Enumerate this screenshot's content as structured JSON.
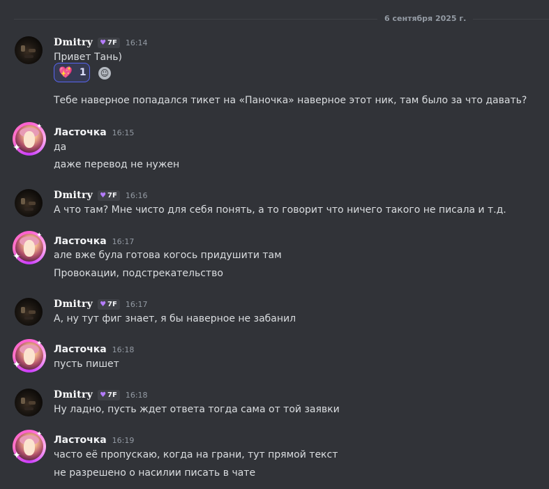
{
  "date_divider": "6 сентября 2025 г.",
  "users": {
    "dmitry": {
      "name": "Dmitry",
      "tag": "7F"
    },
    "swallow": {
      "name": "Ласточка"
    }
  },
  "messages": [
    {
      "author": "Dmitry",
      "tag": "7F",
      "time": "16:14",
      "lines": [
        "Привет Тань)"
      ],
      "reaction": {
        "emoji": "heart-sparkle",
        "count": "1"
      }
    },
    {
      "author": "Dmitry",
      "continued": true,
      "lines": [
        "Тебе наверное попадался тикет на «Паночка» наверное этот ник, там было за что давать?"
      ]
    },
    {
      "author": "Ласточка",
      "time": "16:15",
      "lines": [
        "да",
        "даже перевод не нужен"
      ]
    },
    {
      "author": "Dmitry",
      "tag": "7F",
      "time": "16:16",
      "lines": [
        "А что там? Мне чисто для себя понять, а то говорит что ничего такого не писала и т.д."
      ]
    },
    {
      "author": "Ласточка",
      "time": "16:17",
      "lines": [
        "але вже була готова когось придушити там",
        "Провокации, подстрекательство"
      ]
    },
    {
      "author": "Dmitry",
      "tag": "7F",
      "time": "16:17",
      "lines": [
        "А, ну тут фиг знает, я бы наверное не забанил"
      ]
    },
    {
      "author": "Ласточка",
      "time": "16:18",
      "lines": [
        "пусть пишет"
      ]
    },
    {
      "author": "Dmitry",
      "tag": "7F",
      "time": "16:18",
      "lines": [
        "Ну ладно, пусть ждет ответа тогда сама от той заявки"
      ]
    },
    {
      "author": "Ласточка",
      "time": "16:19",
      "lines": [
        "часто её пропускаю, когда на грани, тут прямой текст",
        "не разрешено о насилии писать в чате"
      ]
    }
  ],
  "colors": {
    "background": "#313338",
    "accent": "#5865f2",
    "tag_heart": "#b57cff"
  }
}
